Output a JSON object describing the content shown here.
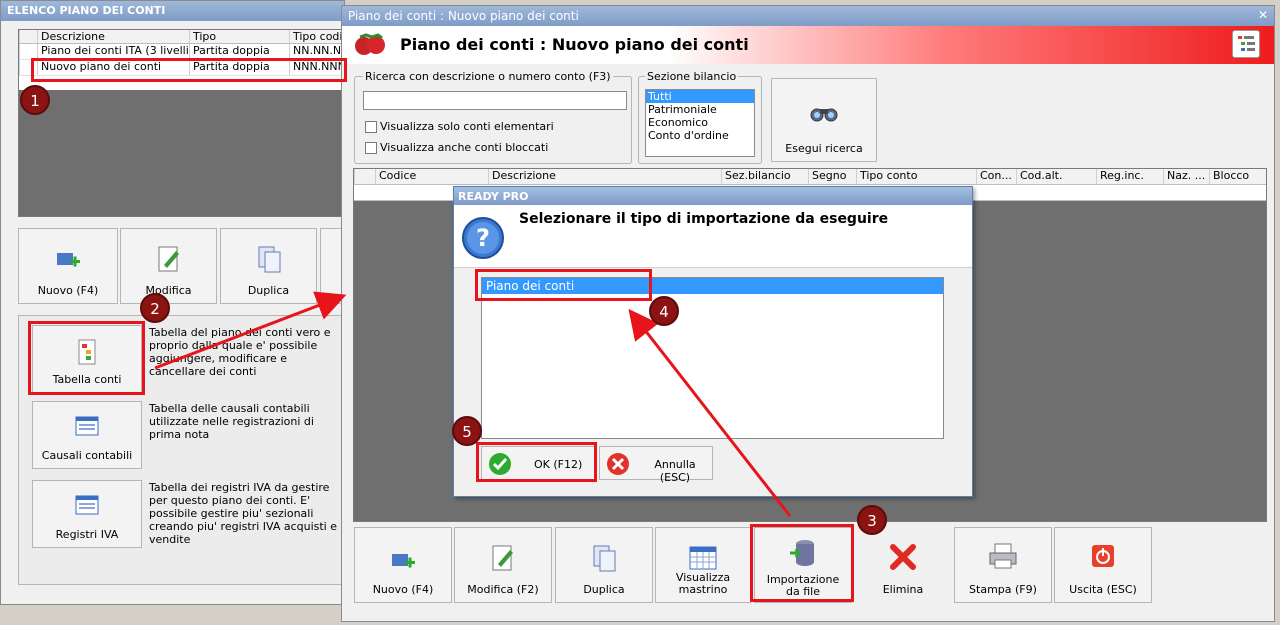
{
  "left_window": {
    "title": "ELENCO PIANO DEI CONTI",
    "columns": [
      "Descrizione",
      "Tipo",
      "Tipo codific"
    ],
    "rows": [
      {
        "descrizione": "Piano dei conti ITA (3 livelli)",
        "tipo": "Partita doppia",
        "codifica": "NN.NN.NNN"
      },
      {
        "descrizione": "Nuovo piano dei conti",
        "tipo": "Partita doppia",
        "codifica": "NNN.NNNN"
      }
    ],
    "buttons": {
      "nuovo": "Nuovo (F4)",
      "modifica": "Modifica",
      "duplica": "Duplica"
    },
    "items": [
      {
        "label": "Tabella conti",
        "desc": "Tabella del piano dei conti vero e proprio dalla quale e' possibile aggiungere, modificare e cancellare dei conti"
      },
      {
        "label": "Causali contabili",
        "desc": "Tabella delle causali contabili utilizzate nelle registrazioni di prima nota"
      },
      {
        "label": "Registri IVA",
        "desc": "Tabella dei registri IVA da gestire per questo piano dei conti. E' possibile gestire piu' sezionali creando piu' registri IVA acquisti e vendite"
      }
    ]
  },
  "main_window": {
    "title": "Piano dei conti : Nuovo piano dei conti",
    "header": "Piano dei conti : Nuovo piano dei conti",
    "search": {
      "label": "Ricerca con descrizione o numero conto (F3)",
      "value": "",
      "chk_elementari": "Visualizza solo conti elementari",
      "chk_bloccati": "Visualizza anche conti bloccati"
    },
    "sezione": {
      "label": "Sezione bilancio",
      "options": [
        "Tutti",
        "Patrimoniale",
        "Economico",
        "Conto d'ordine"
      ],
      "selected": "Tutti"
    },
    "esegui": "Esegui ricerca",
    "columns": [
      "Codice",
      "Descrizione",
      "Sez.bilancio",
      "Segno",
      "Tipo conto",
      "Con...",
      "Cod.alt.",
      "Reg.inc.",
      "Naz. ...",
      "Blocco"
    ],
    "toolbar": {
      "nuovo": "Nuovo (F4)",
      "modifica": "Modifica (F2)",
      "duplica": "Duplica",
      "mastrino": "Visualizza mastrino",
      "importazione": "Importazione da file",
      "elimina": "Elimina",
      "stampa": "Stampa (F9)",
      "uscita": "Uscita (ESC)"
    }
  },
  "dialog": {
    "title": "READY PRO",
    "question": "Selezionare il tipo di importazione da eseguire",
    "options": [
      "Piano dei conti"
    ],
    "ok": "OK (F12)",
    "annulla": "Annulla (ESC)"
  },
  "badges": [
    "1",
    "2",
    "3",
    "4",
    "5"
  ],
  "colors": {
    "accent_red": "#e8141b",
    "badge": "#8b1412",
    "selection": "#3399ff"
  }
}
